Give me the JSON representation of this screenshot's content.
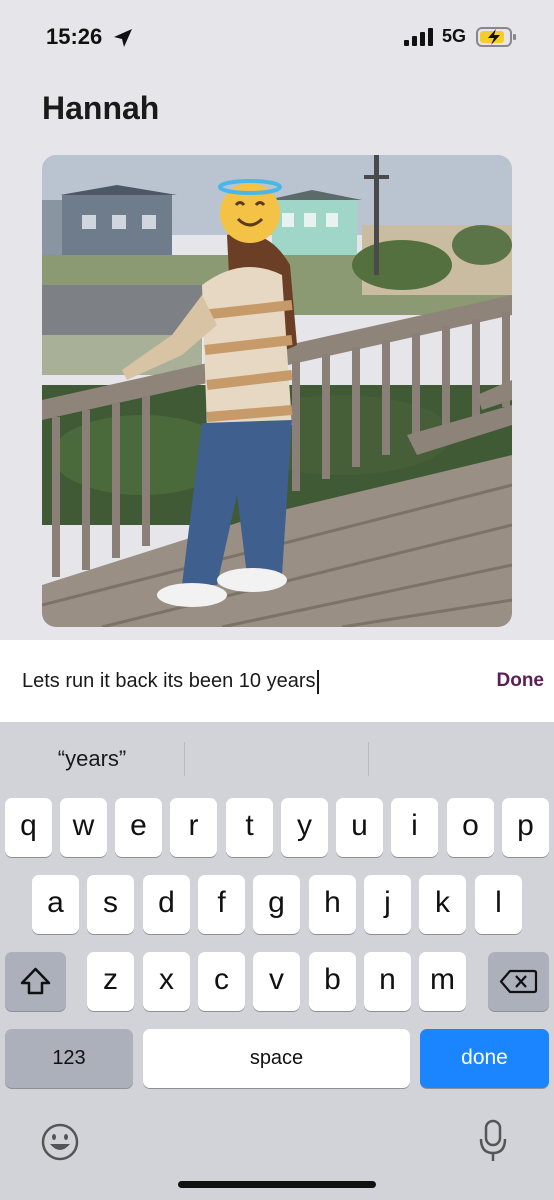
{
  "status_bar": {
    "time": "15:26",
    "network": "5G",
    "icons": [
      "location-arrow-icon",
      "signal-bars-icon",
      "battery-charging-icon"
    ]
  },
  "profile": {
    "name": "Hannah"
  },
  "compose": {
    "value": "Lets run it back its been 10 years",
    "done_label": "Done",
    "accent_color": "#5b1e55"
  },
  "keyboard": {
    "suggestions": [
      "“years”",
      "",
      ""
    ],
    "row1": [
      "q",
      "w",
      "e",
      "r",
      "t",
      "y",
      "u",
      "i",
      "o",
      "p"
    ],
    "row2": [
      "a",
      "s",
      "d",
      "f",
      "g",
      "h",
      "j",
      "k",
      "l"
    ],
    "row3": [
      "z",
      "x",
      "c",
      "v",
      "b",
      "n",
      "m"
    ],
    "numbers_label": "123",
    "space_label": "space",
    "done_label": "done",
    "done_color": "#1b84ff",
    "icons": [
      "shift-icon",
      "backspace-icon",
      "emoji-icon",
      "microphone-icon"
    ]
  }
}
